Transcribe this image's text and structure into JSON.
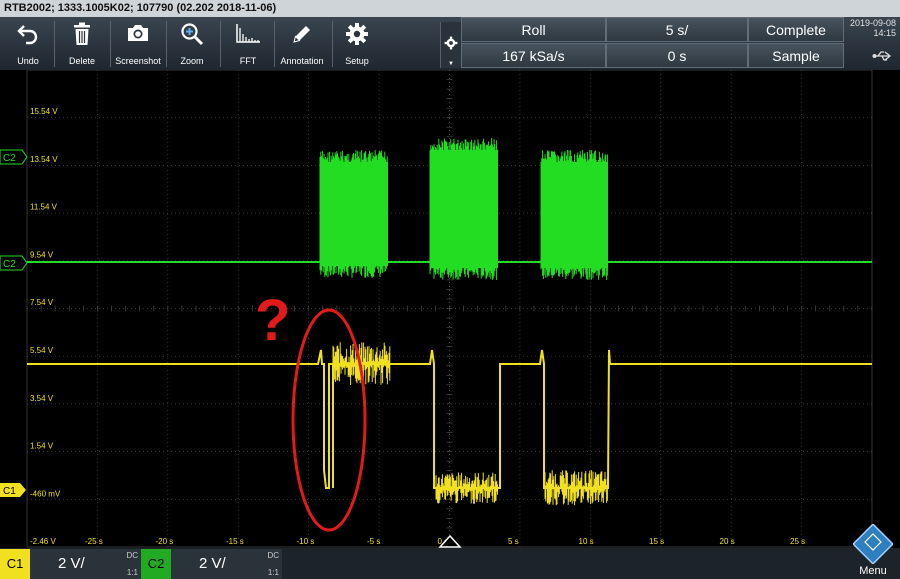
{
  "window": {
    "title": "RTB2002; 1333.1005K02; 107790 (02.202 2018-11-06)"
  },
  "toolbar": {
    "items": [
      {
        "label": "Undo",
        "icon": "undo-icon"
      },
      {
        "label": "Delete",
        "icon": "trash-icon"
      },
      {
        "label": "Screenshot",
        "icon": "camera-icon"
      },
      {
        "label": "Zoom",
        "icon": "zoom-icon"
      },
      {
        "label": "FFT",
        "icon": "fft-icon"
      },
      {
        "label": "Annotation",
        "icon": "pencil-icon"
      },
      {
        "label": "Setup",
        "icon": "gear-icon"
      }
    ]
  },
  "status": {
    "mode": "Roll",
    "timebase": "5 s/",
    "acq_state": "Complete",
    "sample_rate": "167 kSa/s",
    "trigger_offset": "0 s",
    "acq_mode": "Sample",
    "date": "2019-09-08",
    "time": "14:15"
  },
  "plot": {
    "y_labels": [
      "15.54 V",
      "13.54 V",
      "11.54 V",
      "9.54 V",
      "7.54 V",
      "5.54 V",
      "3.54 V",
      "1.54 V",
      "-460 mV",
      "-2.46 V"
    ],
    "x_labels": [
      "-25 s",
      "-20 s",
      "-15 s",
      "-10 s",
      "-5 s",
      "0 s",
      "5 s",
      "10 s",
      "15 s",
      "20 s",
      "25 s"
    ],
    "c2_marker": "C2",
    "c2_marker_top": "C2",
    "c1_marker": "C1",
    "annotation_text": "?",
    "colors": {
      "c1": "#f0e020",
      "c2": "#22dd22",
      "annotation": "#e11a1a",
      "grid": "#4a4a4a"
    }
  },
  "channels": [
    {
      "name": "C1",
      "scale": "2 V/",
      "coupling": "DC",
      "ratio": "1:1",
      "color": "#f0e020"
    },
    {
      "name": "C2",
      "scale": "2 V/",
      "coupling": "DC",
      "ratio": "1:1",
      "color": "#22aa22"
    }
  ],
  "menu": {
    "label": "Menu"
  }
}
